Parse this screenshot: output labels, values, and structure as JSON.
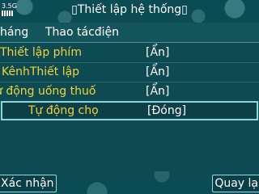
{
  "status": {
    "network": "3.5G"
  },
  "title": "▯Thiết lập hệ thống▯",
  "tabs": [
    "háng",
    "Thao tácđiện"
  ],
  "settings": [
    {
      "label": "Thiết lập phím",
      "value": "[Ẩn]"
    },
    {
      "label": "KênhThiết lập",
      "value": "[Ẩn]"
    },
    {
      "label": "ự động uống thuố",
      "value": "[Ẩn]"
    },
    {
      "label": "Tự động chọ",
      "value": "[Đóng]"
    }
  ],
  "softkeys": {
    "left": "Xác nhận",
    "right": "Quay lạ"
  }
}
